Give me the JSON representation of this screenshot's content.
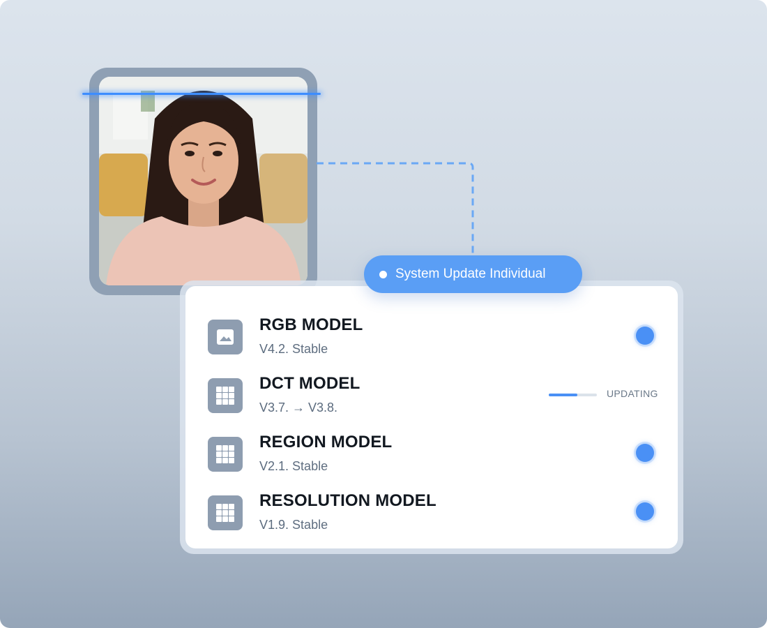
{
  "pill": {
    "label": "System Update Individual"
  },
  "models": [
    {
      "name": "RGB MODEL",
      "version": "V4.2.",
      "status": "Stable",
      "icon": "image-icon",
      "state": "stable"
    },
    {
      "name": "DCT MODEL",
      "version": "V3.7. → V3.8.",
      "status": "",
      "icon": "grid-icon",
      "state": "updating",
      "progress_label": "UPDATING",
      "progress": 0.6
    },
    {
      "name": "REGION MODEL",
      "version": "V2.1.",
      "status": "Stable",
      "icon": "grid-icon",
      "state": "stable"
    },
    {
      "name": "RESOLUTION MODEL",
      "version": "V1.9.",
      "status": "Stable",
      "icon": "grid-icon",
      "state": "stable"
    }
  ],
  "colors": {
    "accent": "#4a90f5",
    "pill": "#5a9ef5",
    "icon_bg": "#8e9db0",
    "frame": "#8fa0b4",
    "scan_line": "#3d8dff"
  }
}
